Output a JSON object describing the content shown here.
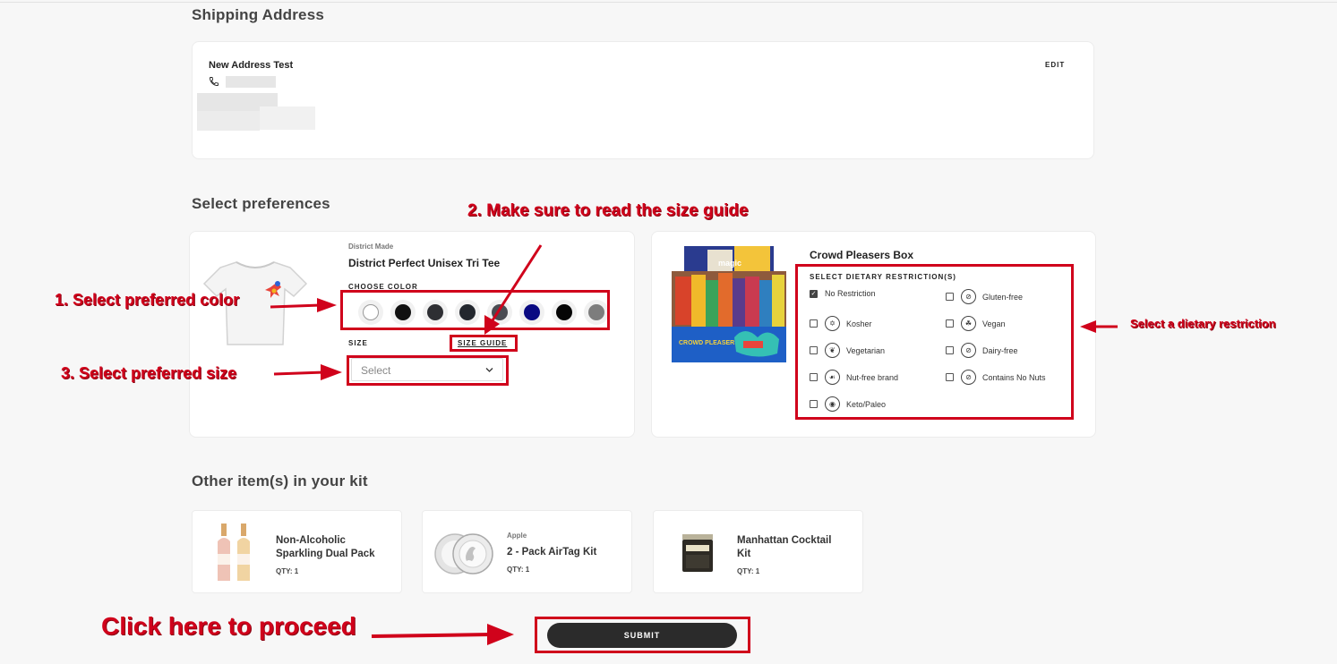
{
  "shipping": {
    "heading": "Shipping Address",
    "name": "New Address Test",
    "edit_label": "EDIT"
  },
  "preferences": {
    "heading": "Select preferences",
    "tee": {
      "brand": "District Made",
      "title": "District Perfect Unisex Tri Tee",
      "color_label": "CHOOSE COLOR",
      "colors": [
        "#ffffff",
        "#111111",
        "#2e2f33",
        "#23272e",
        "#4a4c52",
        "#0a0a82",
        "#050505",
        "#7d7d7d"
      ],
      "size_label": "SIZE",
      "size_guide": "SIZE GUIDE",
      "size_placeholder": "Select"
    },
    "box": {
      "title": "Crowd Pleasers Box",
      "diet_label": "SELECT DIETARY RESTRICTION(S)",
      "box_print_top": "magic",
      "box_print_bottom": "CROWD PLEASERS",
      "options": [
        {
          "label": "No Restriction",
          "checked": true,
          "icon": ""
        },
        {
          "label": "Gluten-free",
          "checked": false,
          "icon": "gluten-free-icon"
        },
        {
          "label": "Kosher",
          "checked": false,
          "icon": "kosher-icon"
        },
        {
          "label": "Vegan",
          "checked": false,
          "icon": "vegan-icon"
        },
        {
          "label": "Vegetarian",
          "checked": false,
          "icon": "vegetarian-icon"
        },
        {
          "label": "Dairy-free",
          "checked": false,
          "icon": "dairy-free-icon"
        },
        {
          "label": "Nut-free brand",
          "checked": false,
          "icon": "nut-free-icon"
        },
        {
          "label": "Contains No Nuts",
          "checked": false,
          "icon": "no-nuts-icon"
        },
        {
          "label": "Keto/Paleo",
          "checked": false,
          "icon": "keto-icon"
        }
      ]
    }
  },
  "kit": {
    "heading": "Other item(s) in your kit",
    "items": [
      {
        "brand": "",
        "name_line1": "Non-Alcoholic",
        "name_line2": "Sparkling Dual Pack",
        "qty": "QTY: 1"
      },
      {
        "brand": "Apple",
        "name_line1": "2 - Pack AirTag Kit",
        "name_line2": "",
        "qty": "QTY: 1"
      },
      {
        "brand": "",
        "name_line1": "Manhattan Cocktail",
        "name_line2": "Kit",
        "qty": "QTY: 1"
      }
    ]
  },
  "submit_label": "SUBMIT",
  "annotations": {
    "color": "1. Select preferred color",
    "size_guide": "2. Make sure to read the size guide",
    "size": "3. Select preferred size",
    "diet": "Select a dietary restriction",
    "proceed": "Click here to proceed"
  },
  "accent_color": "#d0021b"
}
